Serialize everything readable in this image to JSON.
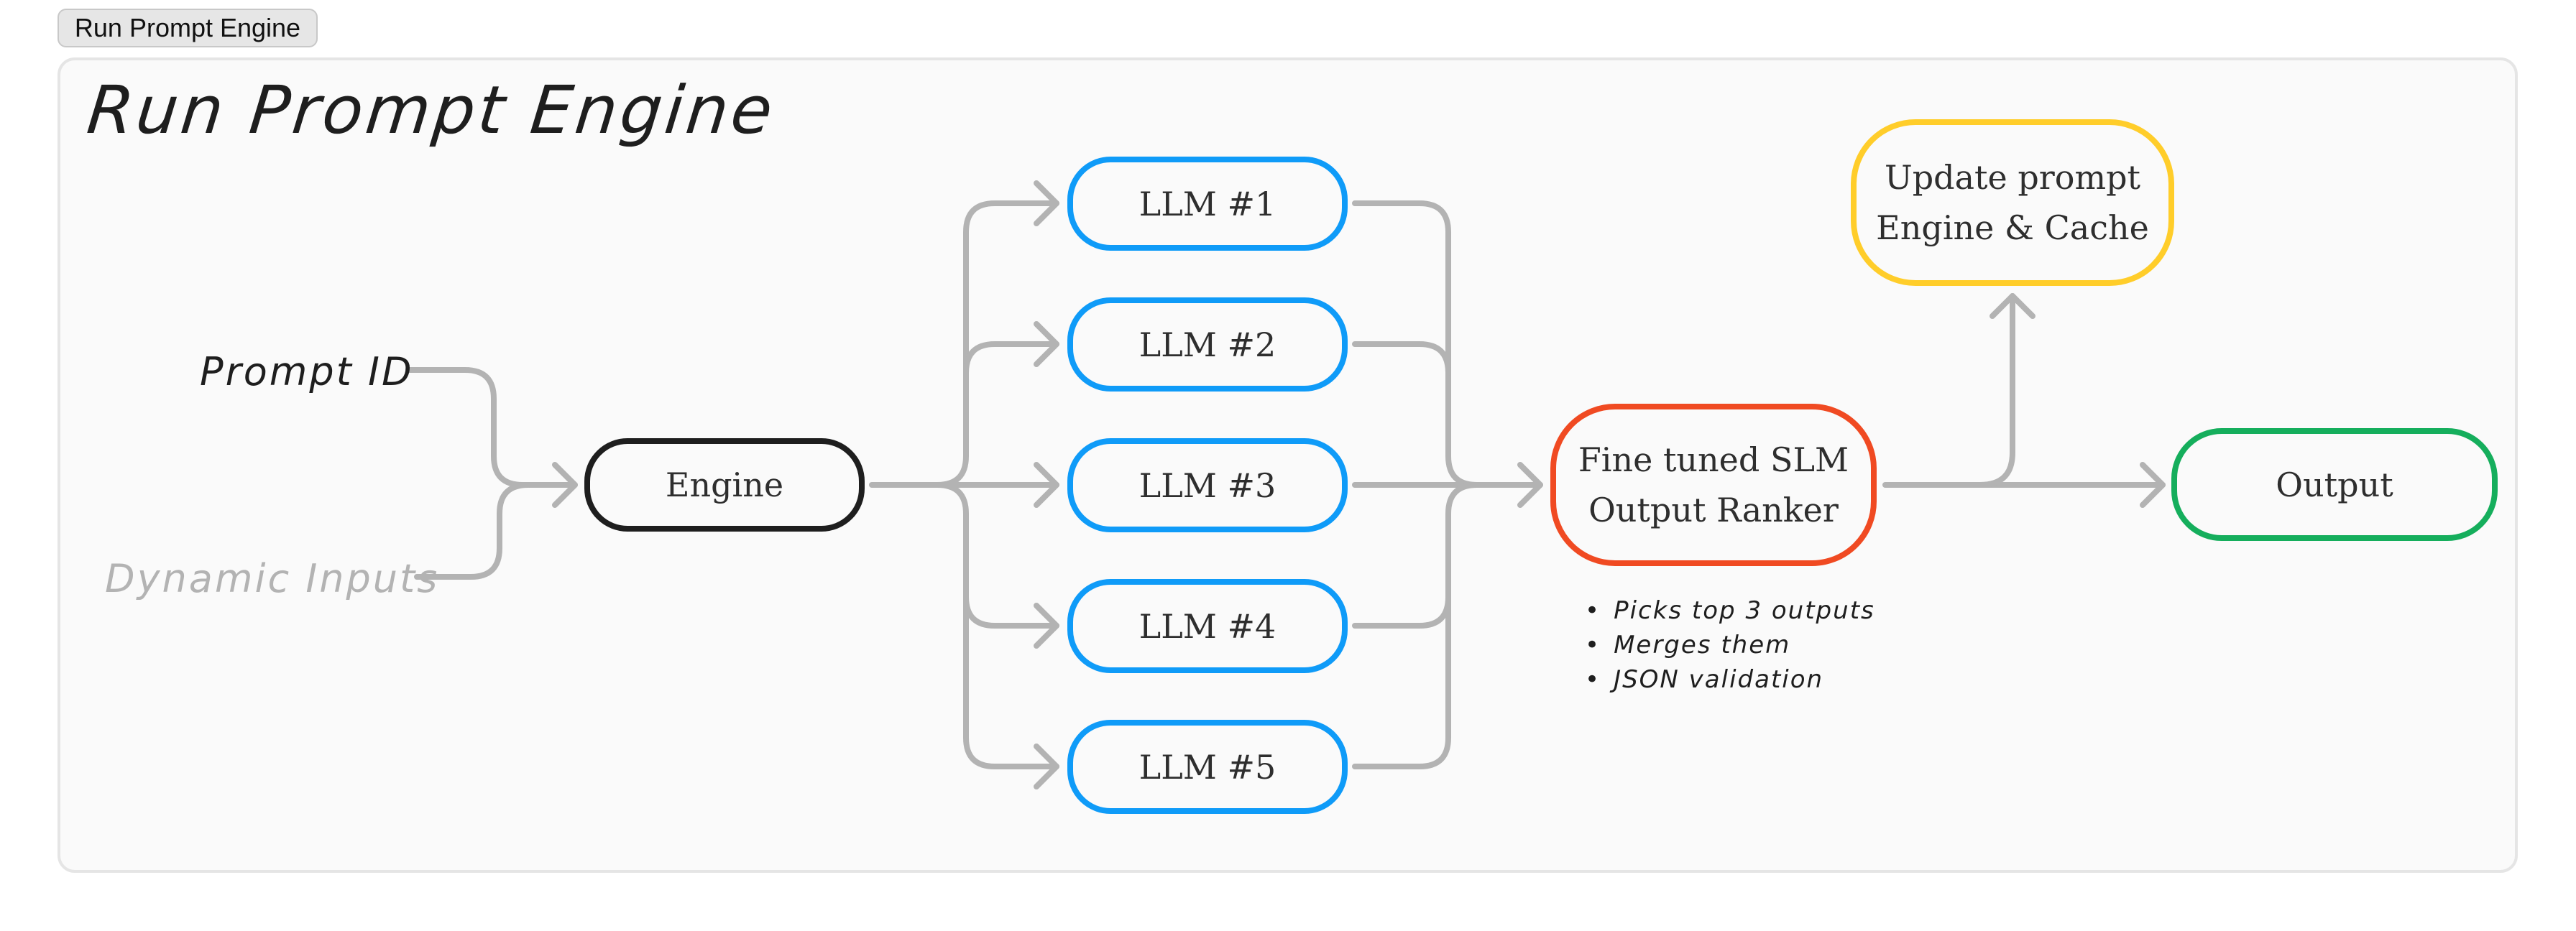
{
  "toolbar": {
    "run_button_label": "Run Prompt Engine"
  },
  "diagram": {
    "title": "Run Prompt Engine",
    "inputs": {
      "prompt_id": "Prompt ID",
      "dynamic_inputs": "Dynamic Inputs"
    },
    "nodes": {
      "engine": "Engine",
      "llms": [
        "LLM #1",
        "LLM #2",
        "LLM #3",
        "LLM #4",
        "LLM #5"
      ],
      "ranker": [
        "Fine tuned SLM",
        "Output Ranker"
      ],
      "update": [
        "Update prompt",
        "Engine & Cache"
      ],
      "output": "Output"
    },
    "ranker_notes": [
      "Picks top 3 outputs",
      "Merges them",
      "JSON validation"
    ],
    "colors": {
      "connector": "#b3b3b3",
      "engine": "#1e1e1e",
      "llm": "#0f9bf8",
      "ranker": "#f04a22",
      "update": "#ffcd2a",
      "output": "#15ae5c",
      "dynamic_inputs_text": "#b3b3b3"
    }
  }
}
